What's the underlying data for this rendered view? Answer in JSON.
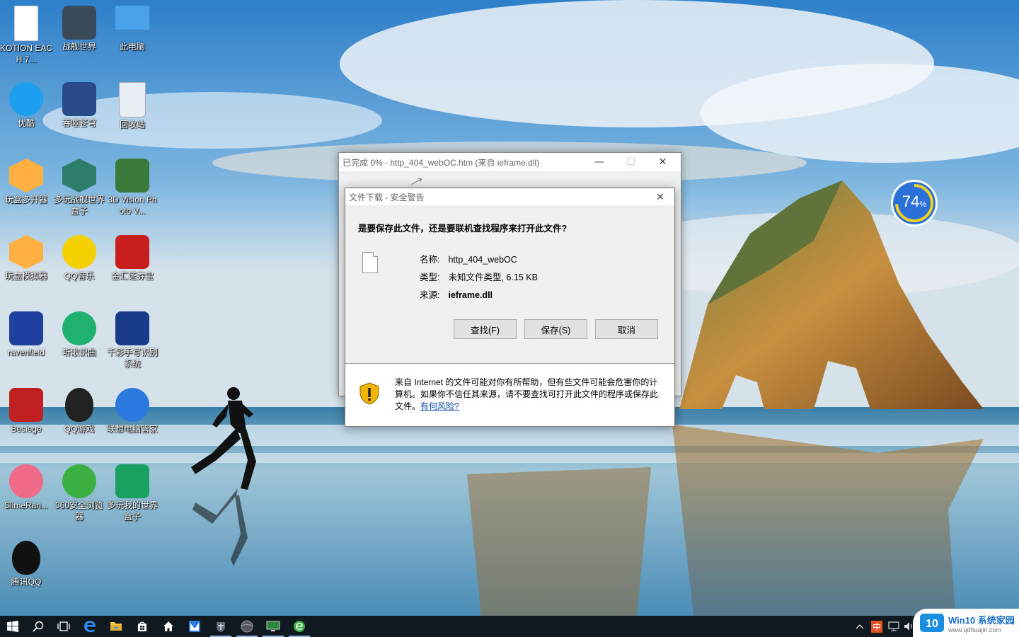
{
  "desktop": {
    "icons": [
      {
        "id": "kotion",
        "label": "KOTION EACH 7...",
        "icon": "document-icon",
        "color": "#ffffff"
      },
      {
        "id": "zhanjianshijie",
        "label": "战舰世界",
        "icon": "warships-icon",
        "color": "#3a4a5a"
      },
      {
        "id": "thispc",
        "label": "此电脑",
        "icon": "computer-icon",
        "color": "#4aa3e8"
      },
      {
        "id": "youku",
        "label": "优酷",
        "icon": "youku-icon",
        "color": "#1ea0f0"
      },
      {
        "id": "tunshi",
        "label": "吞噬苍穹",
        "icon": "tunshi-icon",
        "color": "#2b4a8a"
      },
      {
        "id": "recycle",
        "label": "回收站",
        "icon": "recycle-bin-icon",
        "color": "#e8eef4"
      },
      {
        "id": "wanhe-multi",
        "label": "玩盒多开器",
        "icon": "wanhe-multi-icon",
        "color": "#ffb040"
      },
      {
        "id": "duowan-zj",
        "label": "多玩战舰世界盒子",
        "icon": "duowan-warships-icon",
        "color": "#2e7d6a"
      },
      {
        "id": "3dvision",
        "label": "3D Vision Photo V...",
        "icon": "3d-vision-icon",
        "color": "#3a7a3a"
      },
      {
        "id": "wanhe-emu",
        "label": "玩盒模拟器",
        "icon": "wanhe-emulator-icon",
        "color": "#ffb040"
      },
      {
        "id": "qqmusic",
        "label": "QQ音乐",
        "icon": "qq-music-icon",
        "color": "#f5d000"
      },
      {
        "id": "jinhui",
        "label": "金汇证券宝",
        "icon": "jinhui-icon",
        "color": "#c81e1e"
      },
      {
        "id": "ravenfield",
        "label": "ravenfield",
        "icon": "ravenfield-icon",
        "color": "#2040a0"
      },
      {
        "id": "tingge",
        "label": "听歌识曲",
        "icon": "song-recognition-icon",
        "color": "#20b070"
      },
      {
        "id": "qiancai",
        "label": "千彩手写识别系统",
        "icon": "handwriting-pen-icon",
        "color": "#1a3a8a"
      },
      {
        "id": "besiege",
        "label": "Besiege",
        "icon": "besiege-icon",
        "color": "#c02020"
      },
      {
        "id": "qqgame",
        "label": "QQ游戏",
        "icon": "qq-game-icon",
        "color": "#222222"
      },
      {
        "id": "lenovo",
        "label": "联想电脑管家",
        "icon": "lenovo-manager-icon",
        "color": "#2a7ae0"
      },
      {
        "id": "slime",
        "label": "SlimeRan...",
        "icon": "slime-icon",
        "color": "#f06a8a"
      },
      {
        "id": "360browser",
        "label": "360安全浏览器",
        "icon": "browser-360-icon",
        "color": "#3cb043"
      },
      {
        "id": "duowan-mc",
        "label": "多玩我的世界盒子",
        "icon": "duowan-mc-icon",
        "color": "#1aa060"
      },
      {
        "id": "qq",
        "label": "腾讯QQ",
        "icon": "qq-penguin-icon",
        "color": "#111111"
      }
    ]
  },
  "gauge": {
    "value": "74",
    "unit": "%",
    "fraction": 0.74,
    "color": "#2b6fd8",
    "arc_color": "#f0d020"
  },
  "download_window": {
    "title": "已完成 0% - http_404_webOC.htm (来自 ieframe.dll)",
    "minimize_icon": "—",
    "maximize_icon": "☐",
    "close_icon": "✕"
  },
  "security_dialog": {
    "title": "文件下载 - 安全警告",
    "close_icon": "✕",
    "question": "是要保存此文件，还是要联机查找程序来打开此文件?",
    "fields": [
      {
        "key": "名称:",
        "value": "http_404_webOC"
      },
      {
        "key": "类型:",
        "value": "未知文件类型, 6.15 KB"
      },
      {
        "key": "来源:",
        "value": "ieframe.dll"
      }
    ],
    "buttons": {
      "find": "查找(F)",
      "save": "保存(S)",
      "cancel": "取消"
    },
    "warning_text": "来自 Internet 的文件可能对你有所帮助，但有些文件可能会危害你的计算机。如果你不信任其来源，请不要查找可打开此文件的程序或保存此文件。",
    "warning_link": "有何风险?"
  },
  "taskbar": {
    "items": [
      {
        "name": "start-button",
        "icon": "windows-logo-icon"
      },
      {
        "name": "search-button",
        "icon": "search-icon"
      },
      {
        "name": "task-view-button",
        "icon": "task-view-icon"
      },
      {
        "name": "edge-button",
        "icon": "edge-icon"
      },
      {
        "name": "file-explorer-button",
        "icon": "folder-icon"
      },
      {
        "name": "store-button",
        "icon": "store-icon"
      },
      {
        "name": "home-button",
        "icon": "home-icon"
      },
      {
        "name": "app-button-1",
        "icon": "blue-app-icon"
      },
      {
        "name": "app-button-2",
        "icon": "warships-icon"
      },
      {
        "name": "app-button-3",
        "icon": "globe-icon"
      },
      {
        "name": "app-button-4",
        "icon": "monitor-icon"
      },
      {
        "name": "app-button-5",
        "icon": "browser-360-icon"
      }
    ],
    "tray_ime": "中",
    "watermark_text": "Win10 系统家园",
    "watermark_url": "www.qdhuajin.com"
  }
}
